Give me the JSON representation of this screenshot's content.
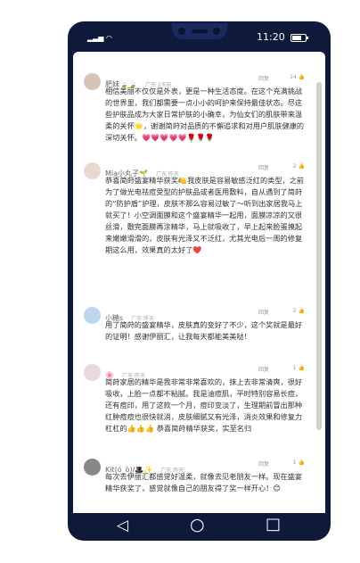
{
  "status": {
    "time": "11:20"
  },
  "comments": [
    {
      "username": "肥妹🍃🍃",
      "meta": "广东 2天前",
      "reply_label": "回复",
      "likes": "14 👍",
      "text": "相信美丽不仅仅是外表，更是一种生活态度。在这个充满挑战的世界里，我们都需要一点小小的呵护来保持最佳状态。尽这些护肤品成为大家日常护肤的小确幸，为仙女们的肌肤带来温柔的关怀🌟，谢谢简莳对品质的不懈追求和对用户肌肤健康的深切关怀。💗💗💗💗💗🌹🌹🌹"
    },
    {
      "username": "Mia小丸子🌱",
      "meta": "广东 昨天",
      "reply_label": "回复",
      "likes": "2 👍",
      "text": "恭喜简莳盛宴精华获奖🍋我皮肤是容易敏感泛红的类型，之前为了做光电祛痘受型的护肤品或者医用敷料，自从遇到了简莳的“防护盾”护理，皮肤不那么容易过敏了～听到出家居我马上就买了！小空调面膜和这个盛宴精华一起用，面膜凉凉的又很丝滑，敷完面膜再涂精华，马上就吸收了，早上起来脸蛋摸起来嫩嫩滑滑的，皮肤有光泽又不泛红，尤其光电后一周的修复期这么用，效果真的太好了❤️"
    },
    {
      "username": "小糖s",
      "meta": "广东 昨天",
      "reply_label": "回复",
      "likes": "2 👍",
      "text": "用了简莳的盛宴精华，皮肤真的变好了不少，这个奖就是最好的证明！感谢伊丽汇，让我每天都能美美哒！"
    },
    {
      "username": "🌸",
      "meta": "广东 昨天",
      "reply_label": "回复",
      "likes": "1 👍",
      "text": "简莳家居的精华是我非常非常喜欢的，抹上去非常清爽，很好吸收，上脸一点都不粘腻。我是油痘肌，平时特别容易长痘，还有痘印，用了这款一个月，痘印变淡了，生理期前冒出那种红肿痘痘也很快就消，皮肤细腻又有光泽，消炎效果和修复力杠杠的👍👍👍 恭喜简莳精华获奖，实至名归"
    },
    {
      "username": "Kit(ó_ò)/🎩✨",
      "meta": "广东 昨天",
      "reply_label": "回复",
      "likes": "1 👍",
      "text": "每次去伊丽汇都感觉好温柔，就像去见老朋友一样。现在盛宴精华获奖了，感觉就像自己的朋友得了奖一样开心！😊"
    }
  ],
  "nav": {
    "back": "◁",
    "home": "○",
    "recent": "□"
  }
}
